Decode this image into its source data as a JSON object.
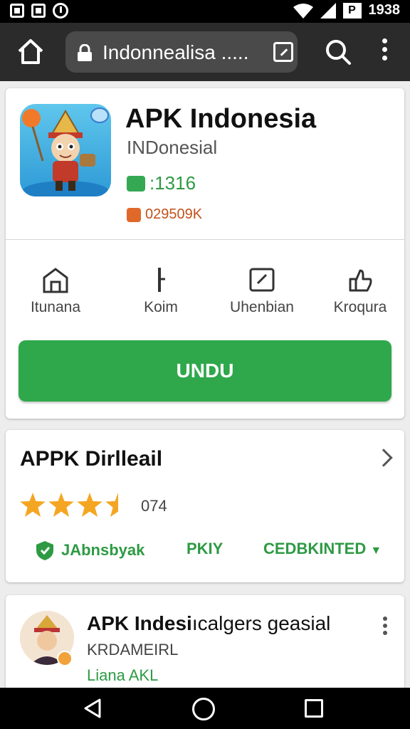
{
  "status_bar": {
    "time": "1938",
    "battery_label": "P"
  },
  "browser": {
    "url": "Indonnealisa ....."
  },
  "app_card": {
    "title": "APK Indonesia",
    "subtitle": "INDonesial",
    "stat_primary": ":1316",
    "stat_secondary": "029509K",
    "features": [
      {
        "label": "Itunana",
        "icon": "store-icon"
      },
      {
        "label": "Koim",
        "icon": "pin-icon"
      },
      {
        "label": "Uhenbian",
        "icon": "edit-icon"
      },
      {
        "label": "Kroqura",
        "icon": "thumb-icon"
      }
    ],
    "download_label": "UNDU"
  },
  "details_card": {
    "title": "APPK Dirlleail",
    "rating": 3.5,
    "rating_count": "074",
    "actions": {
      "first": "JAbnsbyak",
      "second": "PKIY",
      "third": "CEDBKINTED"
    }
  },
  "comment_card": {
    "title_bold": "APK Indesi",
    "title_rest": "ıcalgers geasial",
    "subtitle": "KRDAMEIRL",
    "extra": "Liana AKL"
  },
  "colors": {
    "accent_green": "#2ea84b",
    "browser_bar": "#2b2b2b",
    "stat_orange": "#e0692a"
  }
}
